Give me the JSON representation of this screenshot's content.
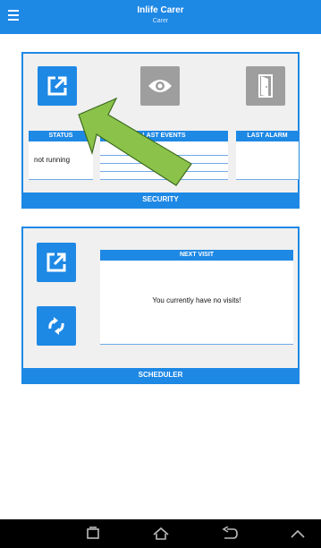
{
  "app": {
    "title": "Inlife Carer",
    "subtitle": "Carer"
  },
  "colors": {
    "accent": "#1e88e5",
    "tile_gray": "#9e9e9e",
    "panel_bg": "#f0f0f0",
    "annotation_arrow": "#8bc34a"
  },
  "security": {
    "footer_label": "SECURITY",
    "tiles": [
      {
        "icon": "open-external-icon",
        "style": "blue"
      },
      {
        "icon": "eye-icon",
        "style": "gray"
      },
      {
        "icon": "door-icon",
        "style": "gray"
      }
    ],
    "status_header": "STATUS",
    "status_value": "not running",
    "last_events_header": "LAST EVENTS",
    "last_alarm_header": "LAST ALARM"
  },
  "scheduler": {
    "footer_label": "SCHEDULER",
    "tiles": [
      {
        "icon": "open-external-icon",
        "style": "blue"
      },
      {
        "icon": "sync-icon",
        "style": "blue"
      }
    ],
    "next_visit_header": "NEXT VISIT",
    "next_visit_message": "You currently have no visits!"
  },
  "navbar": {
    "buttons": [
      "recent-apps-icon",
      "home-icon",
      "back-icon",
      "chevron-up-icon"
    ]
  }
}
